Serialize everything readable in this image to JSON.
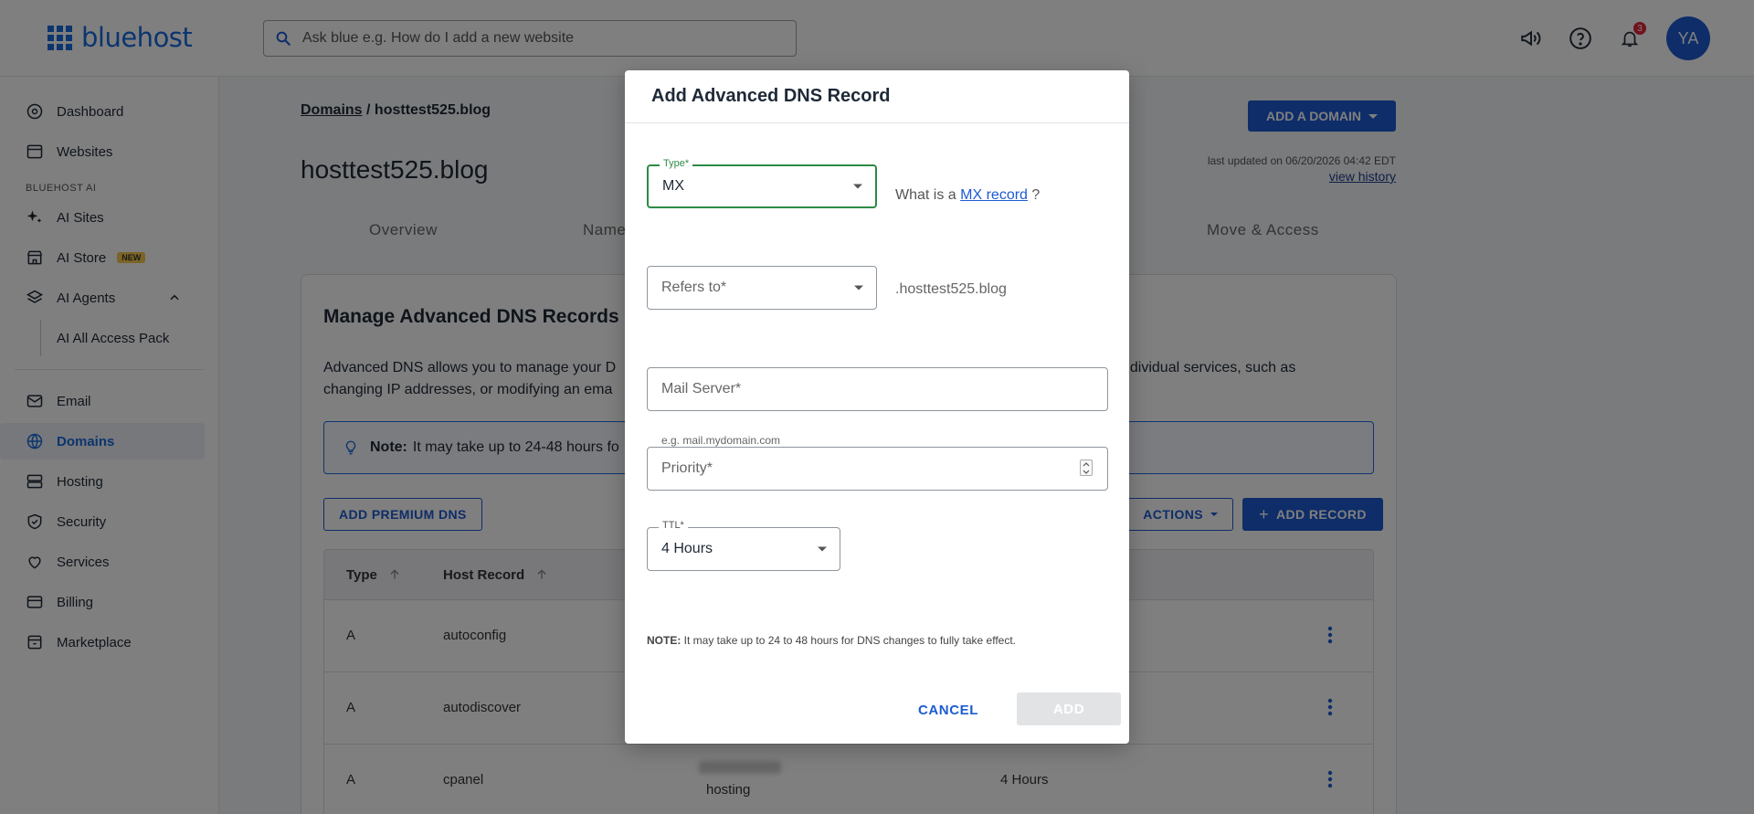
{
  "app": {
    "logo_text": "bluehost",
    "search_placeholder": "Ask blue e.g. How do I add a new website",
    "notifications_count": "3",
    "avatar_initials": "YA",
    "brand_color": "#196bde"
  },
  "sidebar": {
    "items_top": [
      {
        "label": "Dashboard",
        "icon": "dashboard-icon"
      },
      {
        "label": "Websites",
        "icon": "websites-icon"
      }
    ],
    "section_ai": "BLUEHOST AI",
    "ai_items": [
      {
        "label": "AI Sites",
        "icon": "sparkle-icon"
      },
      {
        "label": "AI Store",
        "icon": "store-icon",
        "badge": "NEW"
      },
      {
        "label": "AI Agents",
        "icon": "layers-icon"
      }
    ],
    "ai_sub_item": "AI All Access Pack",
    "items_bottom": [
      {
        "label": "Email",
        "icon": "mail-icon"
      },
      {
        "label": "Domains",
        "icon": "globe-icon",
        "active": true
      },
      {
        "label": "Hosting",
        "icon": "server-icon"
      },
      {
        "label": "Security",
        "icon": "shield-icon"
      },
      {
        "label": "Services",
        "icon": "heart-hand-icon"
      },
      {
        "label": "Billing",
        "icon": "card-icon"
      },
      {
        "label": "Marketplace",
        "icon": "shop-icon"
      }
    ]
  },
  "main": {
    "breadcrumb_root": "Domains",
    "breadcrumb_sep": " / ",
    "breadcrumb_current": "hosttest525.blog",
    "page_title": "hosttest525.blog",
    "add_domain_label": "ADD A DOMAIN",
    "last_updated": "last updated on 06/20/2026 04:42 EDT",
    "view_history": "view history",
    "tabs": [
      "Overview",
      "Name",
      "Move & Access"
    ],
    "card_title": "Manage Advanced DNS Records",
    "card_desc_left": "Advanced DNS allows you to manage your D",
    "card_desc_right": "ndividual services, such as",
    "card_desc_line2": "changing IP addresses, or modifying an ema",
    "note_label": "Note:",
    "note_text": "It may take up to 24-48 hours fo",
    "add_premium_dns": "ADD PREMIUM DNS",
    "actions_label": "ACTIONS",
    "add_record_label": "ADD RECORD",
    "table_headers": {
      "type": "Type",
      "host": "Host Record"
    },
    "rows": [
      {
        "type": "A",
        "host": "autoconfig",
        "value": "",
        "ttl": ""
      },
      {
        "type": "A",
        "host": "autodiscover",
        "value": "",
        "ttl": ""
      },
      {
        "type": "A",
        "host": "cpanel",
        "value": "hosting",
        "ttl": "4 Hours"
      }
    ]
  },
  "modal": {
    "title": "Add Advanced DNS Record",
    "type_label": "Type*",
    "type_value": "MX",
    "help_prefix": "What is a ",
    "help_link": "MX record",
    "help_suffix": " ?",
    "refers_placeholder": "Refers to*",
    "refers_suffix": ".hosttest525.blog",
    "mail_server_placeholder": "Mail Server*",
    "mail_server_hint": "e.g. mail.mydomain.com",
    "priority_placeholder": "Priority*",
    "ttl_label": "TTL*",
    "ttl_value": "4 Hours",
    "note_label": "NOTE:",
    "note_text": " It may take up to 24 to 48 hours for DNS changes to fully take effect.",
    "cancel_label": "CANCEL",
    "add_label": "ADD"
  }
}
